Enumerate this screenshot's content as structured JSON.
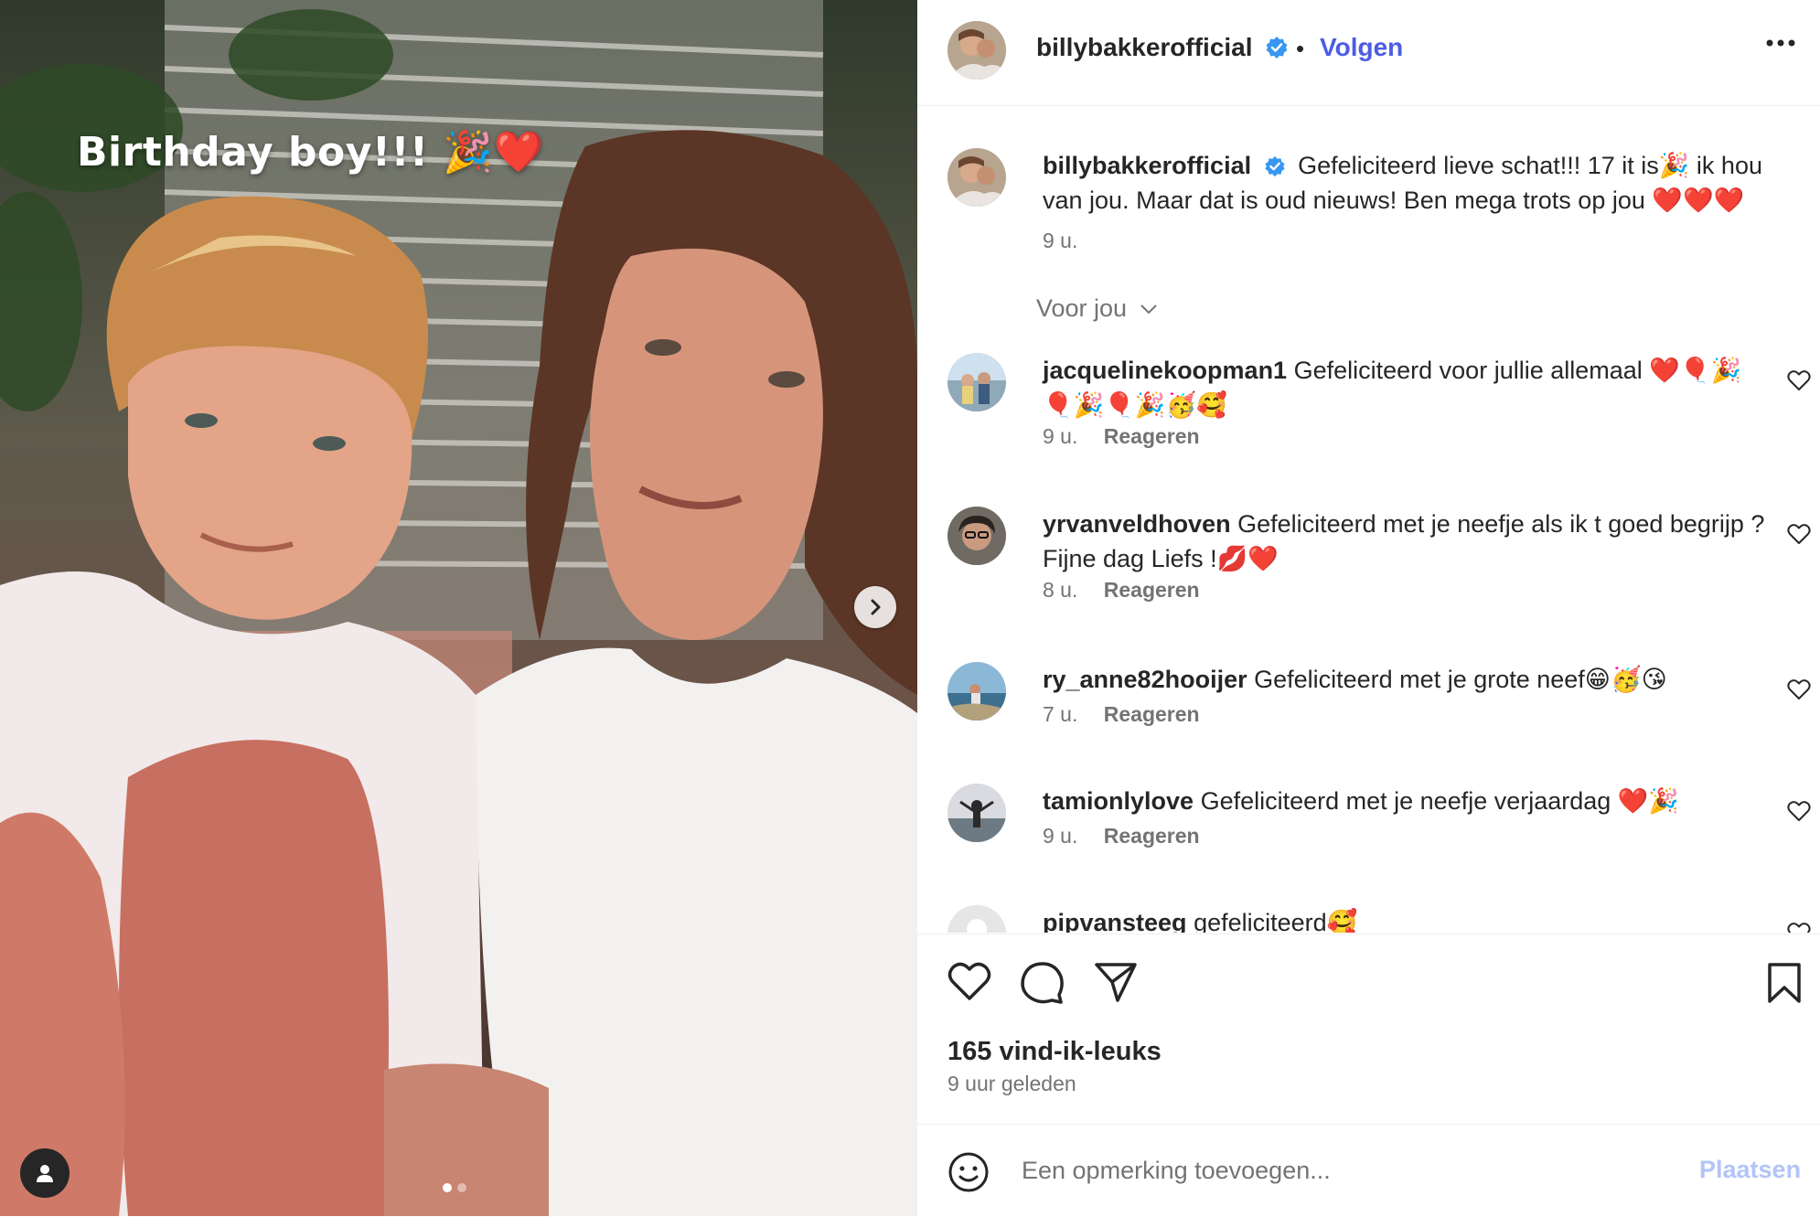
{
  "media": {
    "story_text": "Birthday boy!!! 🎉❤️",
    "carousel_dots": 2,
    "active_dot": 1
  },
  "header": {
    "username": "billybakkerofficial",
    "separator": "•",
    "follow_label": "Volgen"
  },
  "caption": {
    "username": "billybakkerofficial",
    "text": "Gefeliciteerd lieve schat!!! 17 it is🎉 ik hou van jou. Maar dat is oud nieuws! Ben mega trots op jou ❤️❤️❤️",
    "time": "9 u."
  },
  "filter_label": "Voor jou",
  "comments": [
    {
      "username": "jacquelinekoopman1",
      "text": "Gefeliciteerd voor jullie allemaal ❤️🎈🎉🎈🎉🎈🎉🥳🥰",
      "time": "9 u.",
      "reply": "Reageren"
    },
    {
      "username": "yrvanveldhoven",
      "text": "Gefeliciteerd met je neefje als ik t goed begrijp ? Fijne dag Liefs !💋❤️",
      "time": "8 u.",
      "reply": "Reageren"
    },
    {
      "username": "ry_anne82hooijer",
      "text": "Gefeliciteerd met je grote neef😁🥳😘",
      "time": "7 u.",
      "reply": "Reageren"
    },
    {
      "username": "tamionlylove",
      "text": "Gefeliciteerd met je neefje verjaardag ❤️🎉",
      "time": "9 u.",
      "reply": "Reageren"
    },
    {
      "username": "pipvansteeg",
      "text": "gefeliciteerd🥰"
    }
  ],
  "likes": "165 vind-ik-leuks",
  "posted": "9 uur geleden",
  "add_comment": {
    "placeholder": "Een opmerking toevoegen...",
    "post_label": "Plaatsen"
  },
  "colors": {
    "accent": "#4b5ce6",
    "verified": "#3897f0",
    "muted": "#737373",
    "post_disabled": "#b3c4f7"
  },
  "icons": {
    "verified": "verified-badge-icon",
    "more": "more-horizontal-icon",
    "like": "heart-icon",
    "comment": "comment-bubble-icon",
    "share": "paper-plane-icon",
    "save": "bookmark-icon",
    "emoji": "smiley-icon",
    "next": "chevron-right-icon",
    "tag": "person-icon"
  }
}
